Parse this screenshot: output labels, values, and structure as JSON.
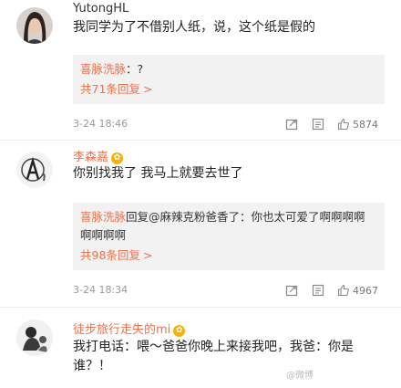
{
  "comments": [
    {
      "username": "YutongHL",
      "text": "我同学为了不借别人纸，说，这个纸是假的",
      "replies": [
        {
          "name": "喜脉洗脉",
          "text": "：?"
        }
      ],
      "reply_count": "共71条回复",
      "time": "3-24 18:46",
      "likes": "5874"
    },
    {
      "username": "李森嘉",
      "text": "你别找我了 我马上就要去世了",
      "replies": [
        {
          "name": "喜脉洗脉",
          "text": "回复@麻辣克粉爸香了：你也太可爱了啊啊啊啊啊啊啊啊"
        }
      ],
      "reply_count": "共98条回复",
      "time": "3-24 18:34",
      "likes": "4967"
    },
    {
      "username": "徒步旅行走失的mi",
      "text": "我打电话：喂～爸爸你晚上来接我吧，我爸：你是谁？！"
    }
  ],
  "vip_badge_symbol": "✿",
  "reply_arrow": ">",
  "watermark": "@微博",
  "colors": {
    "username": "#eb7350",
    "first_username": "#333333",
    "reply_bg": "#f2f2f2",
    "meta": "#999999",
    "vip": "#f5b20a"
  },
  "icons": [
    "share-icon",
    "comment-icon",
    "like-icon"
  ]
}
